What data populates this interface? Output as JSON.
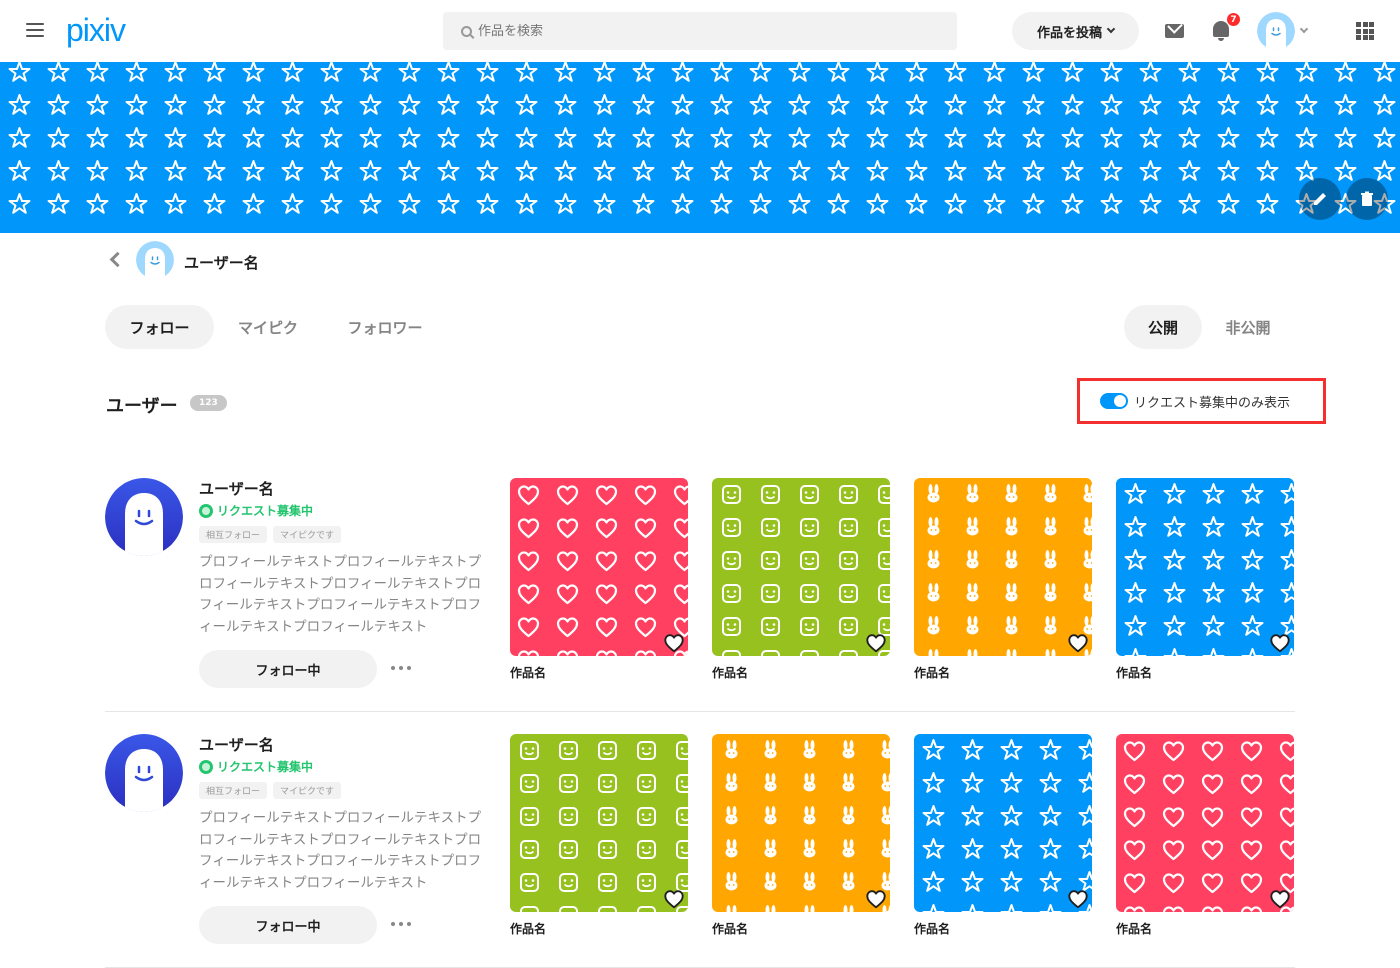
{
  "header": {
    "logo": "pixiv",
    "search_placeholder": "作品を検索",
    "post_button": "作品を投稿",
    "notification_count": "7"
  },
  "colors": {
    "accent": "#0096fa",
    "red": "#ff4060",
    "green": "#96c11f",
    "orange": "#ffa600",
    "blue": "#0096fa",
    "request_green": "#23c56f",
    "highlight_border": "#f42f2f"
  },
  "profile": {
    "name": "ユーザー名"
  },
  "tabs": [
    {
      "label": "フォロー",
      "active": true
    },
    {
      "label": "マイピク",
      "active": false
    },
    {
      "label": "フォロワー",
      "active": false
    }
  ],
  "visibility_tabs": [
    {
      "label": "公開",
      "active": true
    },
    {
      "label": "非公開",
      "active": false
    }
  ],
  "section": {
    "title": "ユーザー",
    "count": "123",
    "filter_label": "リクエスト募集中のみ表示",
    "filter_on": true
  },
  "users": [
    {
      "name": "ユーザー名",
      "request_label": "リクエスト募集中",
      "tags": [
        "相互フォロー",
        "マイピクです"
      ],
      "description": "プロフィールテキストプロフィールテキストプロフィールテキストプロフィールテキストプロフィールテキストプロフィールテキストプロフィールテキストプロフィールテキスト",
      "follow_label": "フォロー中",
      "works": [
        {
          "title": "作品名",
          "pattern": "heart-icon",
          "color": "#ff4060"
        },
        {
          "title": "作品名",
          "pattern": "smile-icon",
          "color": "#96c11f"
        },
        {
          "title": "作品名",
          "pattern": "rabbit-icon",
          "color": "#ffa600"
        },
        {
          "title": "作品名",
          "pattern": "star-icon",
          "color": "#0096fa"
        }
      ]
    },
    {
      "name": "ユーザー名",
      "request_label": "リクエスト募集中",
      "tags": [
        "相互フォロー",
        "マイピクです"
      ],
      "description": "プロフィールテキストプロフィールテキストプロフィールテキストプロフィールテキストプロフィールテキストプロフィールテキストプロフィールテキストプロフィールテキスト",
      "follow_label": "フォロー中",
      "works": [
        {
          "title": "作品名",
          "pattern": "smile-icon",
          "color": "#96c11f"
        },
        {
          "title": "作品名",
          "pattern": "rabbit-icon",
          "color": "#ffa600"
        },
        {
          "title": "作品名",
          "pattern": "star-icon",
          "color": "#0096fa"
        },
        {
          "title": "作品名",
          "pattern": "heart-icon",
          "color": "#ff4060"
        }
      ]
    }
  ]
}
